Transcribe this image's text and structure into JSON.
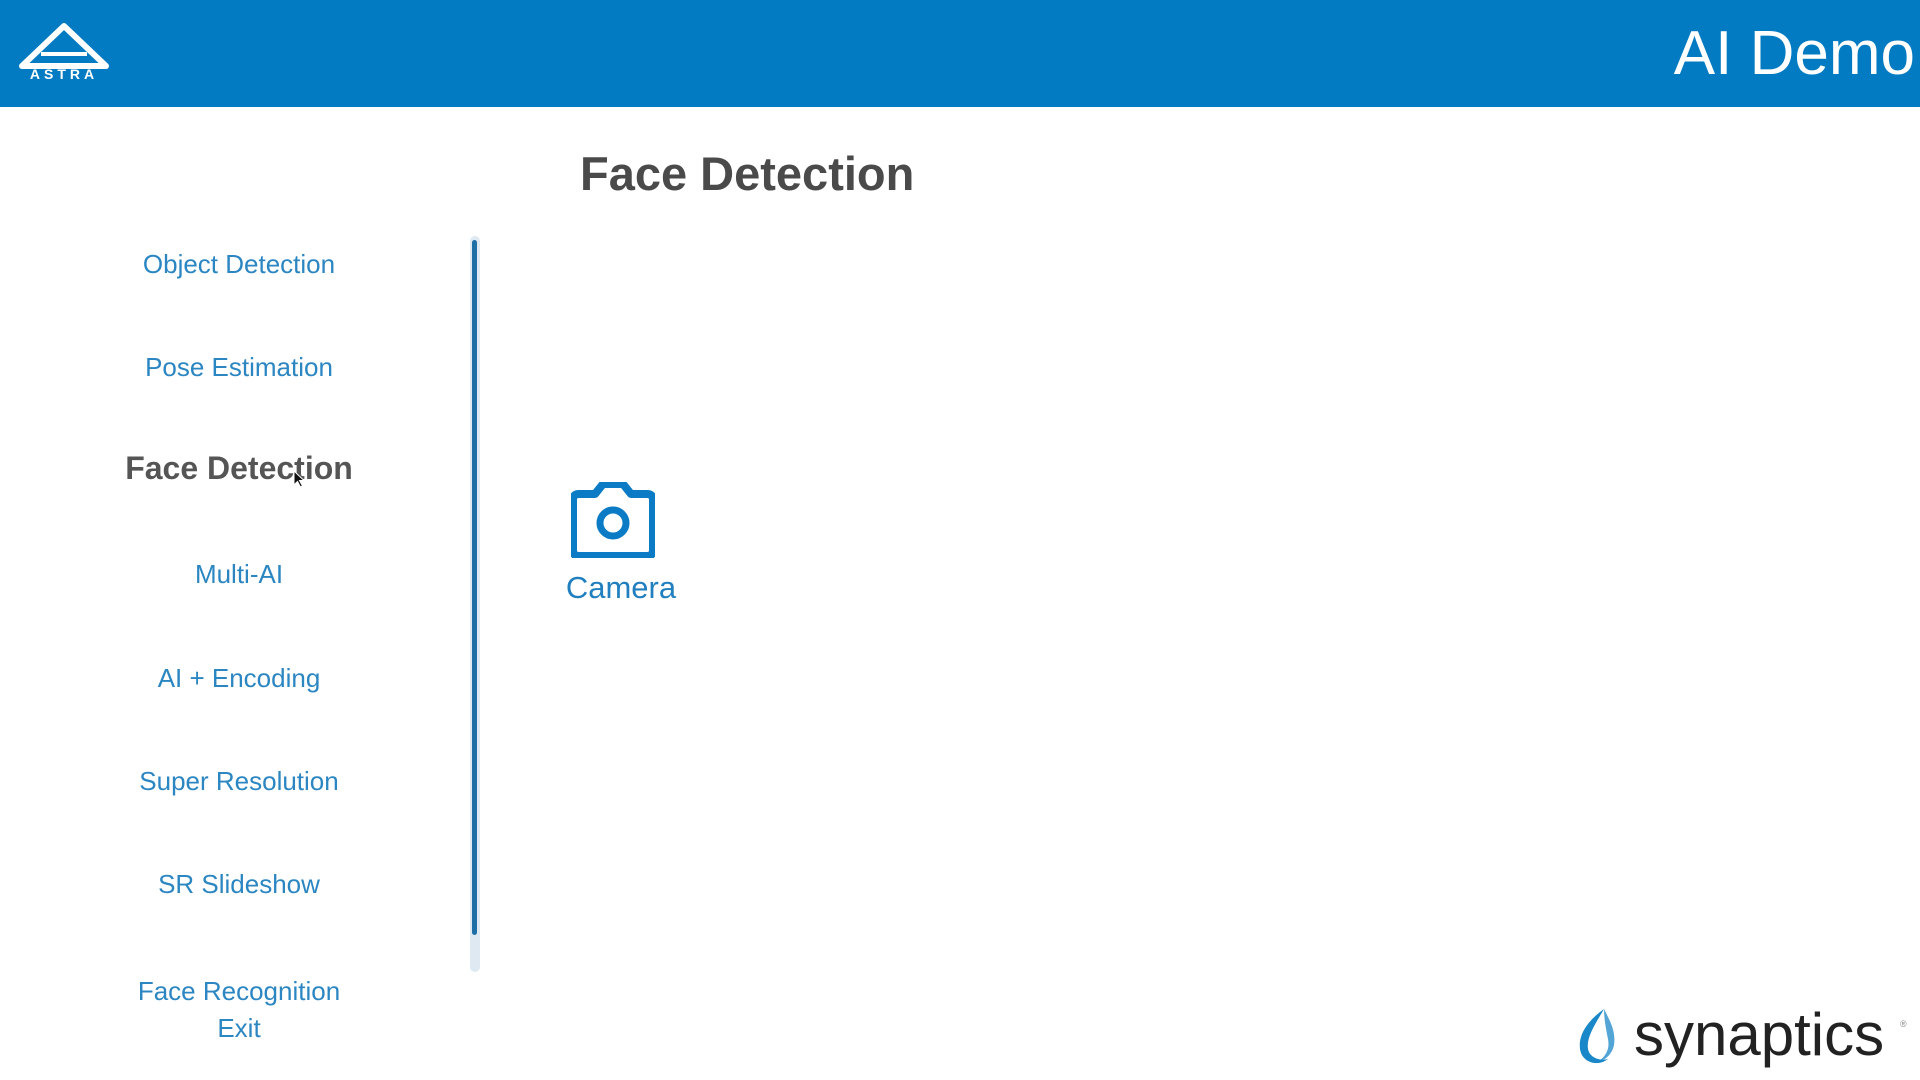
{
  "header": {
    "logo_text": "ASTRA",
    "app_title": "AI Demo"
  },
  "page": {
    "title": "Face Detection"
  },
  "menu": {
    "items": [
      {
        "label": "Object Detection",
        "active": false
      },
      {
        "label": "Pose Estimation",
        "active": false
      },
      {
        "label": "Face Detection",
        "active": true
      },
      {
        "label": "Multi-AI",
        "active": false
      },
      {
        "label": "AI + Encoding",
        "active": false
      },
      {
        "label": "Super Resolution",
        "active": false
      },
      {
        "label": "SR Slideshow",
        "active": false
      },
      {
        "label": "Face Recognition",
        "active": false
      },
      {
        "label": "Exit",
        "active": false
      }
    ]
  },
  "sources": {
    "camera": {
      "label": "Camera",
      "icon": "camera-icon"
    }
  },
  "brand": {
    "name": "synaptics",
    "registered": "®"
  },
  "colors": {
    "header_bg": "#037bc2",
    "accent": "#2b86c2",
    "active_text": "#555555"
  }
}
